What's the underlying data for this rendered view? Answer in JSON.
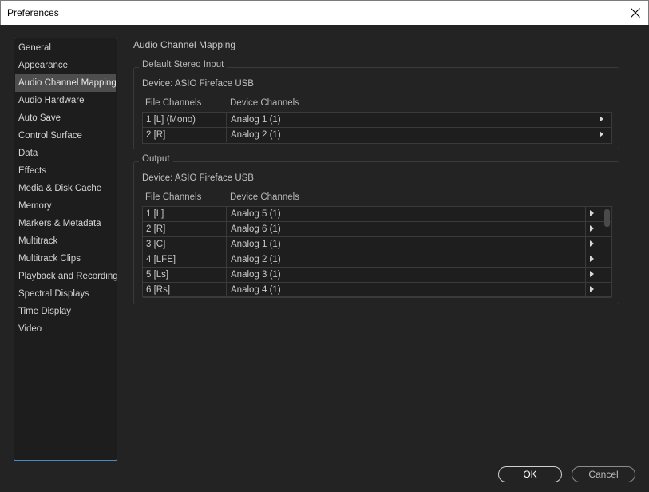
{
  "window": {
    "title": "Preferences"
  },
  "sidebar": {
    "items": [
      {
        "label": "General"
      },
      {
        "label": "Appearance"
      },
      {
        "label": "Audio Channel Mapping",
        "selected": true
      },
      {
        "label": "Audio Hardware"
      },
      {
        "label": "Auto Save"
      },
      {
        "label": "Control Surface"
      },
      {
        "label": "Data"
      },
      {
        "label": "Effects"
      },
      {
        "label": "Media & Disk Cache"
      },
      {
        "label": "Memory"
      },
      {
        "label": "Markers & Metadata"
      },
      {
        "label": "Multitrack"
      },
      {
        "label": "Multitrack Clips"
      },
      {
        "label": "Playback and Recording"
      },
      {
        "label": "Spectral Displays"
      },
      {
        "label": "Time Display"
      },
      {
        "label": "Video"
      }
    ]
  },
  "main": {
    "heading": "Audio Channel Mapping",
    "stereo_input": {
      "title": "Default Stereo Input",
      "device": "Device: ASIO Fireface USB",
      "col_file": "File Channels",
      "col_device": "Device Channels",
      "rows": [
        {
          "file": "1 [L] (Mono)",
          "device": "Analog 1 (1)"
        },
        {
          "file": "2 [R]",
          "device": "Analog 2 (1)"
        }
      ]
    },
    "output": {
      "title": "Output",
      "device": "Device: ASIO Fireface USB",
      "col_file": "File Channels",
      "col_device": "Device Channels",
      "rows": [
        {
          "file": "1 [L]",
          "device": "Analog 5 (1)"
        },
        {
          "file": "2 [R]",
          "device": "Analog 6 (1)"
        },
        {
          "file": "3 [C]",
          "device": "Analog 1 (1)"
        },
        {
          "file": "4 [LFE]",
          "device": "Analog 2 (1)"
        },
        {
          "file": "5 [Ls]",
          "device": "Analog 3 (1)"
        },
        {
          "file": "6 [Rs]",
          "device": "Analog 4 (1)"
        }
      ]
    }
  },
  "buttons": {
    "ok": "OK",
    "cancel": "Cancel"
  },
  "icons": {
    "close": "close-icon",
    "row_expand": "chevron-right-icon"
  },
  "colors": {
    "selection": "#4d4d4d",
    "focus_border": "#4a8ac4",
    "background": "#232323"
  }
}
